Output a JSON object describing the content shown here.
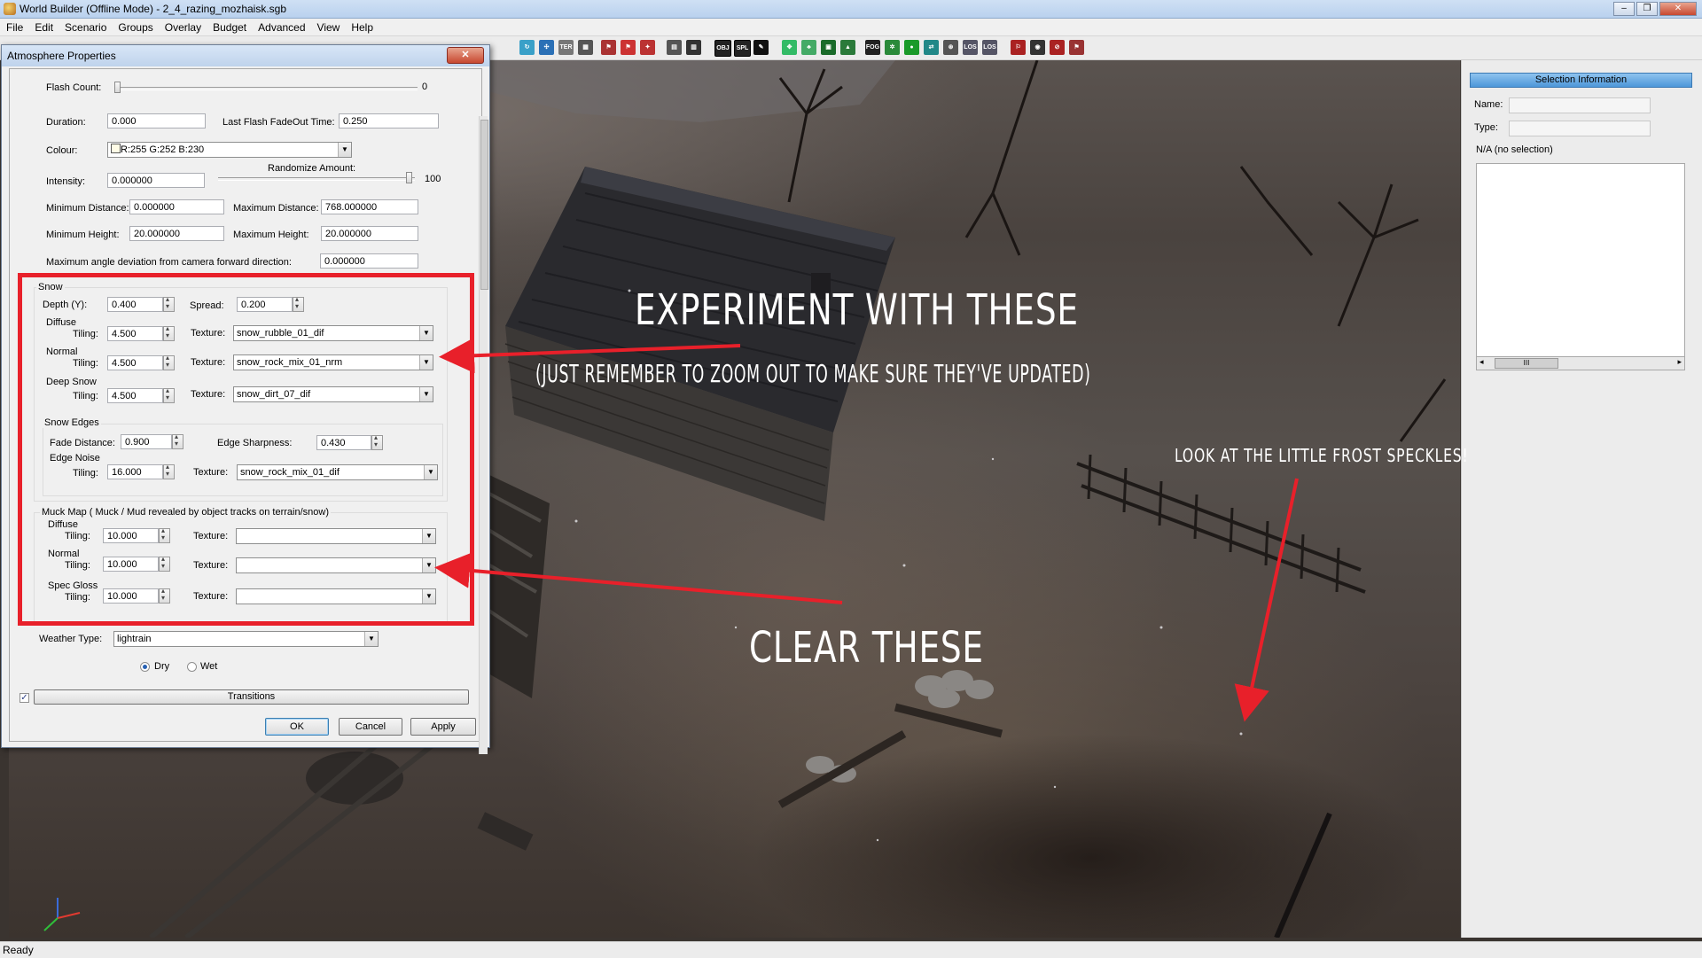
{
  "window": {
    "title": "World Builder (Offline Mode) - 2_4_razing_mozhaisk.sgb",
    "minimize": "–",
    "restore": "❐",
    "close": "✕"
  },
  "menu": [
    "File",
    "Edit",
    "Scenario",
    "Groups",
    "Overlay",
    "Budget",
    "Advanced",
    "View",
    "Help"
  ],
  "toolbar_icons": [
    "OBJ",
    "SPL",
    "TER",
    "FOG",
    "LOS",
    "LOS"
  ],
  "dialog": {
    "title": "Atmosphere Properties",
    "close_glyph": "✕",
    "flash_count_label": "Flash Count:",
    "flash_count_value": "0",
    "duration_label": "Duration:",
    "duration_value": "0.000",
    "last_flash_label": "Last Flash FadeOut Time:",
    "last_flash_value": "0.250",
    "colour_label": "Colour:",
    "colour_value": "R:255 G:252 B:230",
    "intensity_label": "Intensity:",
    "intensity_value": "0.000000",
    "randomize_label": "Randomize Amount:",
    "randomize_value": "100",
    "min_distance_label": "Minimum Distance:",
    "min_distance_value": "0.000000",
    "max_distance_label": "Maximum Distance:",
    "max_distance_value": "768.000000",
    "min_height_label": "Minimum Height:",
    "min_height_value": "20.000000",
    "max_height_label": "Maximum Height:",
    "max_height_value": "20.000000",
    "max_angle_label": "Maximum angle deviation from camera forward direction:",
    "max_angle_value": "0.000000",
    "snow": {
      "group_label": "Snow",
      "depth_label": "Depth (Y):",
      "depth_value": "0.400",
      "spread_label": "Spread:",
      "spread_value": "0.200",
      "diffuse_label": "Diffuse",
      "normal_label": "Normal",
      "deep_snow_label": "Deep Snow",
      "tiling_label": "Tiling:",
      "texture_label": "Texture:",
      "diffuse_tiling": "4.500",
      "diffuse_texture": "snow_rubble_01_dif",
      "normal_tiling": "4.500",
      "normal_texture": "snow_rock_mix_01_nrm",
      "deep_tiling": "4.500",
      "deep_texture": "snow_dirt_07_dif",
      "edges_label": "Snow Edges",
      "fade_distance_label": "Fade Distance:",
      "fade_distance_value": "0.900",
      "edge_sharpness_label": "Edge Sharpness:",
      "edge_sharpness_value": "0.430",
      "edge_noise_label": "Edge Noise",
      "edge_noise_tiling": "16.000",
      "edge_noise_texture": "snow_rock_mix_01_dif"
    },
    "muck": {
      "group_label": "Muck Map ( Muck / Mud revealed by object tracks on terrain/snow)",
      "diffuse_label": "Diffuse",
      "normal_label": "Normal",
      "spec_label": "Spec Gloss",
      "diffuse_tiling": "10.000",
      "normal_tiling": "10.000",
      "spec_tiling": "10.000",
      "diffuse_texture": "",
      "normal_texture": "",
      "spec_texture": ""
    },
    "weather_type_label": "Weather Type:",
    "weather_type_value": "lightrain",
    "dry_label": "Dry",
    "wet_label": "Wet",
    "transitions_label": "Transitions",
    "ok_label": "OK",
    "cancel_label": "Cancel",
    "apply_label": "Apply"
  },
  "selection_panel": {
    "header": "Selection Information",
    "name_label": "Name:",
    "type_label": "Type:",
    "status": "N/A (no selection)",
    "scroll_grip": "III"
  },
  "annotations": {
    "experiment": "EXPERIMENT WITH THESE",
    "remember": "(JUST REMEMBER TO ZOOM OUT TO MAKE SURE THEY'VE UPDATED)",
    "clear": "CLEAR THESE",
    "frost": "LOOK AT THE LITTLE FROST SPECKLES!"
  },
  "status_bar": "Ready",
  "colors": {
    "annotation_red": "#e8202a",
    "selection_header": "#4d97d9"
  }
}
